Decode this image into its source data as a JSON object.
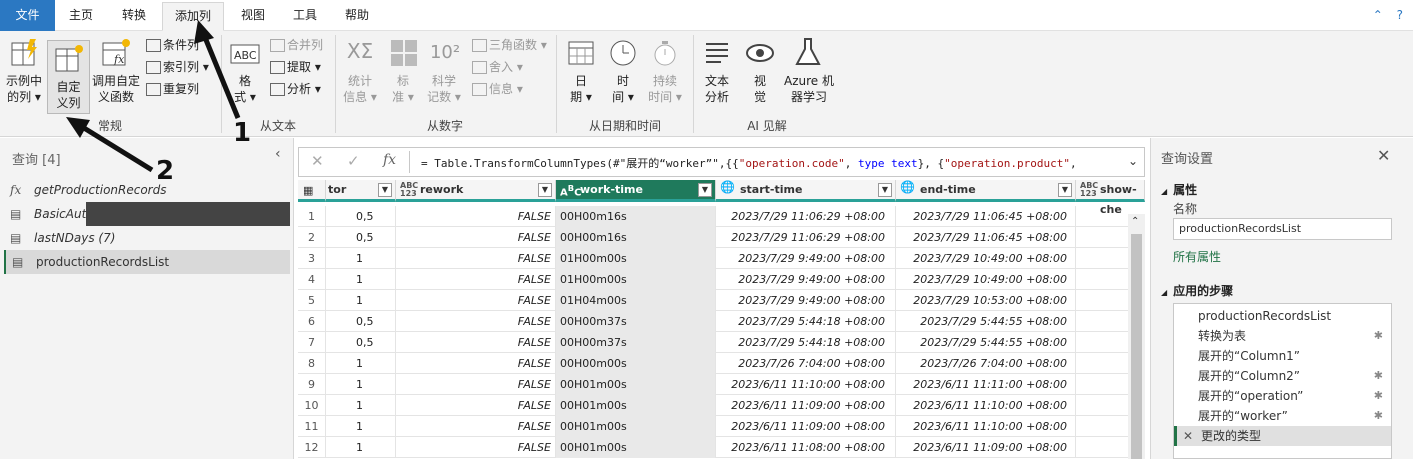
{
  "menu": {
    "file": "文件",
    "tabs": [
      "主页",
      "转换",
      "添加列",
      "视图",
      "工具",
      "帮助"
    ],
    "active_tab": "添加列"
  },
  "ribbon": {
    "general": {
      "example_col": [
        "示例中",
        "的列 ▾"
      ],
      "custom_col": [
        "自定",
        "义列"
      ],
      "invoke_fn": [
        "调用自定",
        "义函数"
      ],
      "conditional": "条件列",
      "index": "索引列 ▾",
      "duplicate": "重复列",
      "label": "常规"
    },
    "from_text": {
      "format": [
        "格",
        "式 ▾"
      ],
      "merge": "合并列",
      "extract": "提取 ▾",
      "parse": "分析 ▾",
      "label": "从文本"
    },
    "from_number": {
      "stats": [
        "统计",
        "信息 ▾"
      ],
      "standard": [
        "标",
        "准 ▾"
      ],
      "scientific": [
        "科学",
        "记数 ▾"
      ],
      "trig": "三角函数 ▾",
      "rounding": "舍入 ▾",
      "info": "信息 ▾",
      "label": "从数字"
    },
    "from_datetime": {
      "date": [
        "日",
        "期 ▾"
      ],
      "time": [
        "时",
        "间 ▾"
      ],
      "duration": [
        "持续",
        "时间 ▾"
      ],
      "label": "从日期和时间"
    },
    "ai": {
      "text_analytics": [
        "文本",
        "分析"
      ],
      "vision": [
        "视",
        "觉"
      ],
      "azure_ml": [
        "Azure 机",
        "器学习"
      ],
      "label": "AI 见解"
    }
  },
  "left_panel": {
    "title": "查询 [4]",
    "queries": [
      {
        "name": "getProductionRecords",
        "icon": "fx"
      },
      {
        "name": "BasicAuth",
        "icon": "table"
      },
      {
        "name": "lastNDays (7)",
        "icon": "table"
      },
      {
        "name": "productionRecordsList",
        "icon": "table"
      }
    ]
  },
  "formula": {
    "prefix": "= Table.TransformColumnTypes(#\"展开的“worker”\",{{",
    "s1": "\"operation.code\"",
    "mid1": ", ",
    "k1": "type text",
    "mid2": "}, {",
    "s2": "\"operation.product\"",
    "tail": ","
  },
  "grid": {
    "columns": [
      {
        "name": "tor",
        "type": "",
        "selected": false
      },
      {
        "name": "rework",
        "type": "ABC 123",
        "selected": false
      },
      {
        "name": "work-time",
        "type": "A B C",
        "selected": true
      },
      {
        "name": "start-time",
        "type": "globe",
        "selected": false
      },
      {
        "name": "end-time",
        "type": "globe",
        "selected": false
      },
      {
        "name": "show-che",
        "type": "ABC 123",
        "selected": false
      }
    ],
    "rows": [
      [
        "1",
        "0,5",
        "FALSE",
        "00H00m16s",
        "2023/7/29 11:06:29 +08:00",
        "2023/7/29 11:06:45 +08:00"
      ],
      [
        "2",
        "0,5",
        "FALSE",
        "00H00m16s",
        "2023/7/29 11:06:29 +08:00",
        "2023/7/29 11:06:45 +08:00"
      ],
      [
        "3",
        "1",
        "FALSE",
        "01H00m00s",
        "2023/7/29 9:49:00 +08:00",
        "2023/7/29 10:49:00 +08:00"
      ],
      [
        "4",
        "1",
        "FALSE",
        "01H00m00s",
        "2023/7/29 9:49:00 +08:00",
        "2023/7/29 10:49:00 +08:00"
      ],
      [
        "5",
        "1",
        "FALSE",
        "01H04m00s",
        "2023/7/29 9:49:00 +08:00",
        "2023/7/29 10:53:00 +08:00"
      ],
      [
        "6",
        "0,5",
        "FALSE",
        "00H00m37s",
        "2023/7/29 5:44:18 +08:00",
        "2023/7/29 5:44:55 +08:00"
      ],
      [
        "7",
        "0,5",
        "FALSE",
        "00H00m37s",
        "2023/7/29 5:44:18 +08:00",
        "2023/7/29 5:44:55 +08:00"
      ],
      [
        "8",
        "1",
        "FALSE",
        "00H00m00s",
        "2023/7/26 7:04:00 +08:00",
        "2023/7/26 7:04:00 +08:00"
      ],
      [
        "9",
        "1",
        "FALSE",
        "00H01m00s",
        "2023/6/11 11:10:00 +08:00",
        "2023/6/11 11:11:00 +08:00"
      ],
      [
        "10",
        "1",
        "FALSE",
        "00H01m00s",
        "2023/6/11 11:09:00 +08:00",
        "2023/6/11 11:10:00 +08:00"
      ],
      [
        "11",
        "1",
        "FALSE",
        "00H01m00s",
        "2023/6/11 11:09:00 +08:00",
        "2023/6/11 11:10:00 +08:00"
      ],
      [
        "12",
        "1",
        "FALSE",
        "00H01m00s",
        "2023/6/11 11:08:00 +08:00",
        "2023/6/11 11:09:00 +08:00"
      ]
    ]
  },
  "right_panel": {
    "title": "查询设置",
    "properties": "属性",
    "name_label": "名称",
    "name_value": "productionRecordsList",
    "all_props": "所有属性",
    "steps_title": "应用的步骤",
    "steps": [
      {
        "name": "productionRecordsList",
        "gear": false
      },
      {
        "name": "转换为表",
        "gear": true
      },
      {
        "name": "展开的“Column1”",
        "gear": false
      },
      {
        "name": "展开的“Column2”",
        "gear": true
      },
      {
        "name": "展开的“operation”",
        "gear": true
      },
      {
        "name": "展开的“worker”",
        "gear": true
      },
      {
        "name": "更改的类型",
        "gear": false
      }
    ]
  },
  "annotations": {
    "n1": "1",
    "n2": "2"
  }
}
